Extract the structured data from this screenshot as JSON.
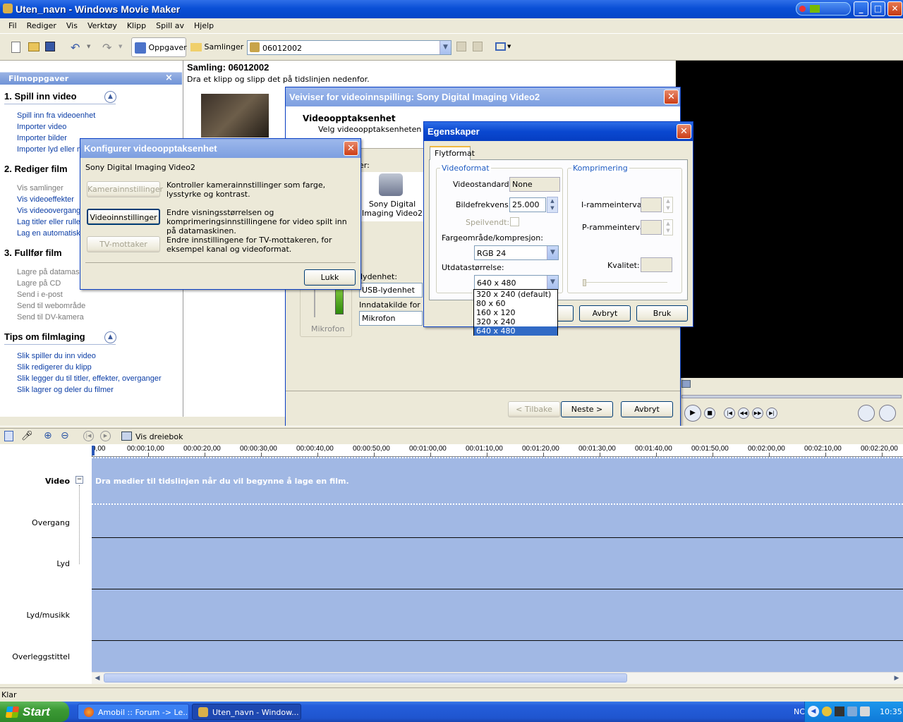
{
  "window": {
    "title": "Uten_navn - Windows Movie Maker"
  },
  "menu": [
    "Fil",
    "Rediger",
    "Vis",
    "Verktøy",
    "Klipp",
    "Spill av",
    "Hjelp"
  ],
  "toolbar": {
    "tasks_label": "Oppgaver",
    "collections_label": "Samlinger",
    "collection_value": "06012002"
  },
  "tasks_pane": {
    "header": "Filmoppgaver",
    "close": "×",
    "sections": [
      {
        "title": "1. Spill inn video",
        "items": [
          "Spill inn fra videoenhet",
          "Importer video",
          "Importer bilder",
          "Importer lyd eller m"
        ]
      },
      {
        "title": "2. Rediger film",
        "items": [
          "Vis samlinger",
          "Vis videoeffekter",
          "Vis videoovergang",
          "Lag titler eller rulle",
          "Lag en automatisk"
        ]
      },
      {
        "title": "3. Fullfør film",
        "items": [
          "Lagre på datamask",
          "Lagre på CD",
          "Send i e-post",
          "Send til webområde",
          "Send til DV-kamera"
        ]
      },
      {
        "title": "Tips om filmlaging",
        "items": [
          "Slik spiller du inn video",
          "Slik redigerer du klipp",
          "Slik legger du til titler, effekter, overganger",
          "Slik lagrer og deler du filmer"
        ]
      }
    ]
  },
  "collection": {
    "title": "Samling: 06012002",
    "hint": "Dra et klipp og slipp det på tidslinjen nedenfor."
  },
  "wizard": {
    "title": "Veiviser for videoinnspilling: Sony Digital Imaging Video2",
    "heading": "Videoopptaksenhet",
    "subheading": "Velg videoopptaksenheten du v",
    "devices_label": "er:",
    "device_name": "Sony Digital Imaging Video2",
    "audio_device_label": "lydenhet:",
    "audio_device_value": "USB-lydenhet",
    "input_source_label": "Inndatakilde for lyd",
    "input_source_value": "Mikrofon",
    "mic_label": "Mikrofon",
    "back": "< Tilbake",
    "next": "Neste >",
    "cancel": "Avbryt"
  },
  "configure": {
    "title": "Konfigurer videoopptaksenhet",
    "device": "Sony Digital Imaging Video2",
    "rows": [
      {
        "button": "Kamerainnstillinger",
        "text": "Kontroller kamerainnstillinger som farge, lysstyrke og kontrast.",
        "enabled": false
      },
      {
        "button": "Videoinnstillinger",
        "text": "Endre visningsstørrelsen og komprimeringsinnstillingene for video spilt inn på datamaskinen.",
        "enabled": true
      },
      {
        "button": "TV-mottaker",
        "text": "Endre innstillingene for TV-mottakeren, for eksempel kanal og videoformat.",
        "enabled": false
      }
    ],
    "close": "Lukk"
  },
  "properties": {
    "title": "Egenskaper",
    "tab": "Flytformat",
    "videoformat_group": "Videoformat",
    "compression_group": "Komprimering",
    "videostandard_label": "Videostandard:",
    "videostandard_value": "None",
    "framerate_label": "Bildefrekvens:",
    "framerate_value": "25.000",
    "flipped_label": "Speilvendt:",
    "colorspace_label": "Fargeområde/kompresjon:",
    "colorspace_value": "RGB 24",
    "outputsize_label": "Utdatastørrelse:",
    "outputsize_value": "640 x 480",
    "outputsize_options": [
      "320 x 240  (default)",
      "80 x 60",
      "160 x 120",
      "320 x 240",
      "640 x 480"
    ],
    "outputsize_selected": "640 x 480",
    "iframe_label": "I-rammeintervall:",
    "pframe_label": "P-rammeintervall:",
    "quality_label": "Kvalitet:",
    "cancel": "Avbryt",
    "apply": "Bruk"
  },
  "timeline": {
    "storyboard_label": "Vis dreiebok",
    "ticks": [
      "0,00",
      "00:00:10,00",
      "00:00:20,00",
      "00:00:30,00",
      "00:00:40,00",
      "00:00:50,00",
      "00:01:00,00",
      "00:01:10,00",
      "00:01:20,00",
      "00:01:30,00",
      "00:01:40,00",
      "00:01:50,00",
      "00:02:00,00",
      "00:02:10,00",
      "00:02:20,00"
    ],
    "tracks": [
      "Video",
      "Overgang",
      "Lyd",
      "Lyd/musikk",
      "Overleggstittel"
    ],
    "drop_hint": "Dra medier til tidslinjen når du vil begynne å lage en film."
  },
  "status": "Klar",
  "taskbar": {
    "start": "Start",
    "tasks": [
      "Amobil :: Forum -> Le...",
      "Uten_navn - Window..."
    ],
    "lang": "NC",
    "clock": "10:35"
  }
}
